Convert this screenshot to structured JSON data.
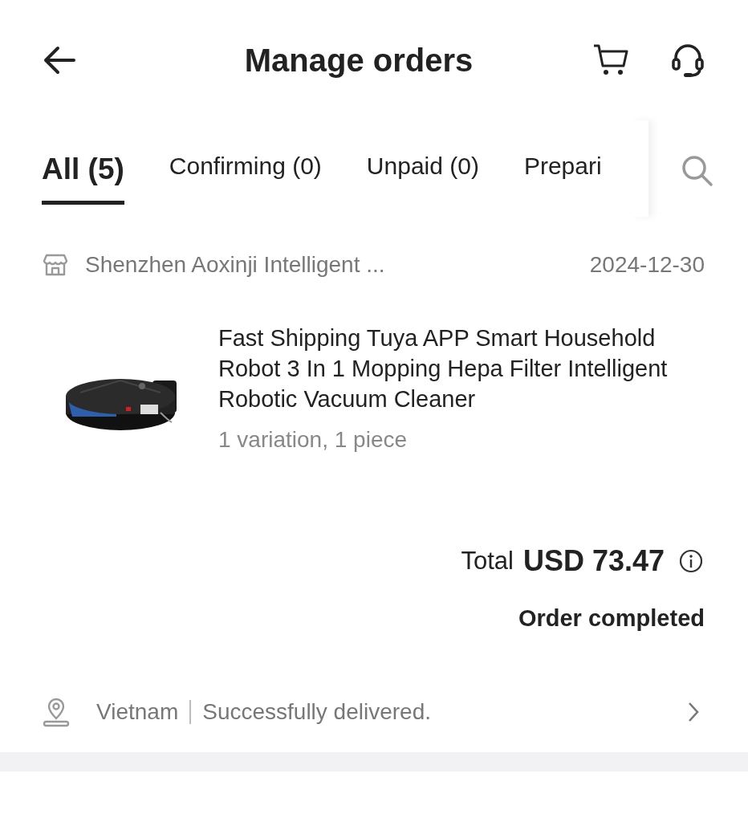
{
  "header": {
    "title": "Manage orders"
  },
  "tabs": [
    {
      "label": "All (5)",
      "selected": true
    },
    {
      "label": "Confirming (0)",
      "selected": false
    },
    {
      "label": "Unpaid (0)",
      "selected": false
    },
    {
      "label": "Prepari",
      "selected": false
    }
  ],
  "order": {
    "store": "Shenzhen Aoxinji Intelligent ...",
    "date": "2024-12-30",
    "product": {
      "title": "Fast Shipping Tuya APP Smart Household Robot 3 In 1 Mopping Hepa Filter Intelligent Robotic Vacuum Cleaner",
      "variation": "1 variation, 1 piece"
    },
    "total_label": "Total",
    "total": "USD 73.47",
    "status": "Order completed",
    "destination": "Vietnam",
    "delivery": "Successfully delivered."
  }
}
